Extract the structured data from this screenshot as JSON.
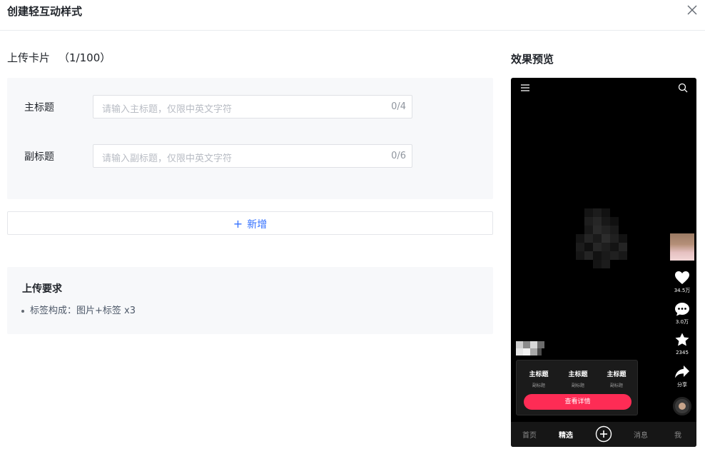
{
  "dialog": {
    "title": "创建轻互动样式"
  },
  "upload": {
    "title": "上传卡片",
    "count": "（1/100）",
    "fields": [
      {
        "label": "主标题",
        "placeholder": "请输入主标题，仅限中英文字符",
        "counter": "0/4"
      },
      {
        "label": "副标题",
        "placeholder": "请输入副标题，仅限中英文字符",
        "counter": "0/6"
      }
    ],
    "add_label": "新增"
  },
  "requirements": {
    "title": "上传要求",
    "items": [
      "标签构成：图片+标签 x3"
    ]
  },
  "preview": {
    "title": "效果预览",
    "rail": {
      "likes": "34.5万",
      "comments": "3.0万",
      "favorites": "2345",
      "share": "分享"
    },
    "card": {
      "items": [
        {
          "title": "主标题",
          "subtitle": "副标题"
        },
        {
          "title": "主标题",
          "subtitle": "副标题"
        },
        {
          "title": "主标题",
          "subtitle": "副标题"
        }
      ],
      "cta": "查看详情"
    },
    "tabs": {
      "home": "首页",
      "featured": "精选",
      "messages": "消息",
      "me": "我"
    }
  },
  "colors": {
    "accent": "#3370ff",
    "cta": "#fe2c55",
    "panel": "#f7f8fa"
  }
}
